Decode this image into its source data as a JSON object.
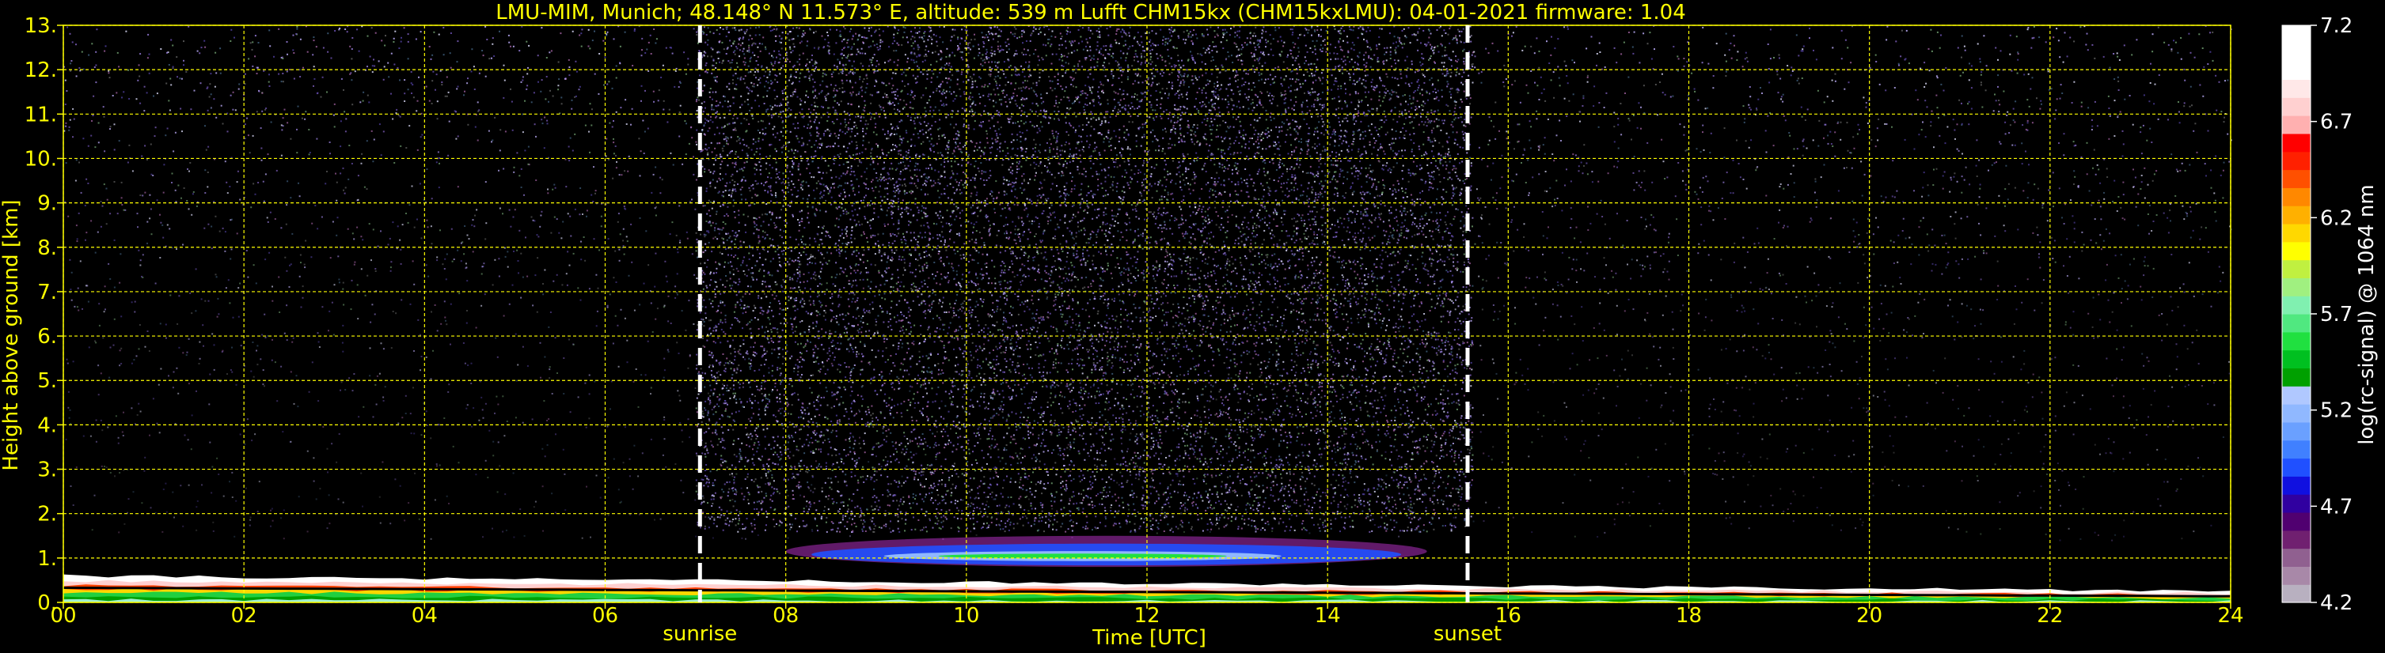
{
  "chart_data": {
    "type": "heatmap",
    "title": "LMU-MIM, Munich; 48.148° N 11.573° E, altitude: 539 m    Lufft CHM15kx (CHM15kxLMU): 04-01-2021    firmware: 1.04",
    "xlabel": "Time [UTC]",
    "ylabel": "Height above ground [km]",
    "xlim": [
      0,
      24
    ],
    "ylim": [
      0,
      13
    ],
    "x_ticks": [
      "00",
      "02",
      "04",
      "06",
      "08",
      "10",
      "12",
      "14",
      "16",
      "18",
      "20",
      "22",
      "24"
    ],
    "x_tick_values": [
      0,
      2,
      4,
      6,
      8,
      10,
      12,
      14,
      16,
      18,
      20,
      22,
      24
    ],
    "y_ticks": [
      "0.",
      "1.",
      "2.",
      "3.",
      "4.",
      "5.",
      "6.",
      "7.",
      "8.",
      "9.",
      "10.",
      "11.",
      "12.",
      "13."
    ],
    "y_tick_values": [
      0,
      1,
      2,
      3,
      4,
      5,
      6,
      7,
      8,
      9,
      10,
      11,
      12,
      13
    ],
    "grid": true,
    "grid_color": "#ffff00",
    "annotations": [
      {
        "label": "sunrise",
        "x": 7.05
      },
      {
        "label": "sunset",
        "x": 15.55
      }
    ],
    "colorbar": {
      "label": "log(rc-signal) @ 1064 nm",
      "min": 4.2,
      "max": 7.2,
      "ticks": [
        "7.2",
        "6.7",
        "6.2",
        "5.7",
        "5.2",
        "4.7",
        "4.2"
      ],
      "tick_values": [
        7.2,
        6.7,
        6.2,
        5.7,
        5.2,
        4.7,
        4.2
      ],
      "colors_bottom_to_top": [
        "#b8b0c0",
        "#a888a8",
        "#906090",
        "#702070",
        "#500070",
        "#3000a0",
        "#1010e0",
        "#2050ff",
        "#4080ff",
        "#6aa0ff",
        "#90b8ff",
        "#b0c8ff",
        "#00a000",
        "#00c020",
        "#20e040",
        "#50e880",
        "#80f0b0",
        "#a0f080",
        "#c0f040",
        "#ffff00",
        "#ffd800",
        "#ffb000",
        "#ff8800",
        "#ff5000",
        "#ff2000",
        "#ff0000",
        "#ffb0b0",
        "#ffd0d0",
        "#ffe8e8",
        "#ffffff",
        "#ffffff",
        "#ffffff"
      ]
    },
    "layers": [
      {
        "name": "boundary-layer",
        "x_start": 0,
        "x_end": 24,
        "height_start": 0.6,
        "height_end": 0.25,
        "value": 7.2
      },
      {
        "name": "cloud-layer",
        "x_start": 8.0,
        "x_end": 15.1,
        "base": 0.8,
        "top": 1.5,
        "core_value": 5.2
      },
      {
        "name": "background-noise-day",
        "x_start": 7.0,
        "x_end": 15.6,
        "top": 13,
        "value": 4.6
      },
      {
        "name": "background-noise-night",
        "x_start": 0,
        "x_end": 24,
        "top": 13,
        "value": 4.3
      }
    ]
  }
}
